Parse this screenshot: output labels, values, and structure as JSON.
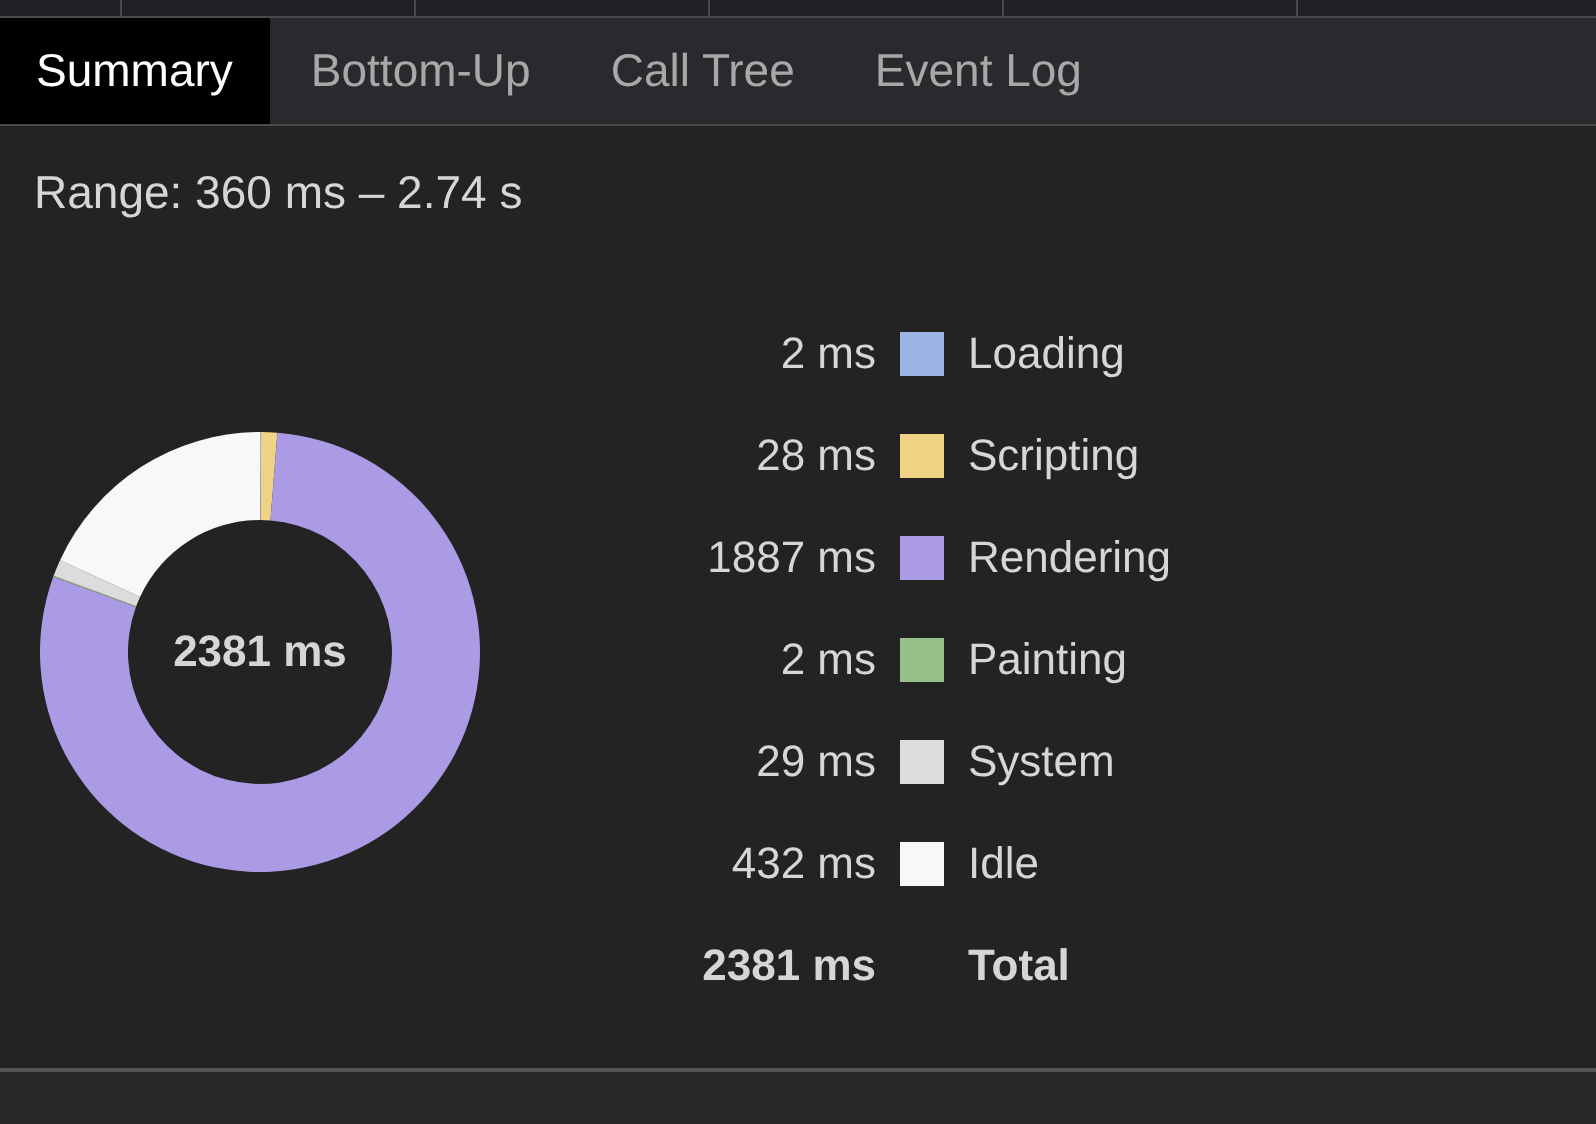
{
  "tabs": [
    {
      "label": "Summary",
      "selected": true
    },
    {
      "label": "Bottom-Up",
      "selected": false
    },
    {
      "label": "Call Tree",
      "selected": false
    },
    {
      "label": "Event Log",
      "selected": false
    }
  ],
  "range": "Range: 360 ms – 2.74 s",
  "chart": {
    "center_label": "2381 ms",
    "chart_data": {
      "type": "donut",
      "categories": [
        "Loading",
        "Scripting",
        "Rendering",
        "Painting",
        "System",
        "Idle"
      ],
      "series": [
        {
          "values": [
            0.08,
            1.18,
            79.29,
            0.08,
            1.22,
            18.15
          ]
        }
      ]
    }
  },
  "legend": [
    {
      "value": "2 ms",
      "color": "#9ab5e4"
    },
    {
      "value": "28 ms",
      "color": "#f0d284"
    },
    {
      "value": "1887 ms",
      "color": "#ab9be5"
    },
    {
      "value": "2 ms",
      "color": "#98c08b"
    },
    {
      "value": "29 ms",
      "color": "#dcdcdc"
    },
    {
      "value": "432 ms",
      "color": "#f8f8f8"
    }
  ],
  "total": {
    "value": "2381 ms",
    "label": "Total"
  }
}
